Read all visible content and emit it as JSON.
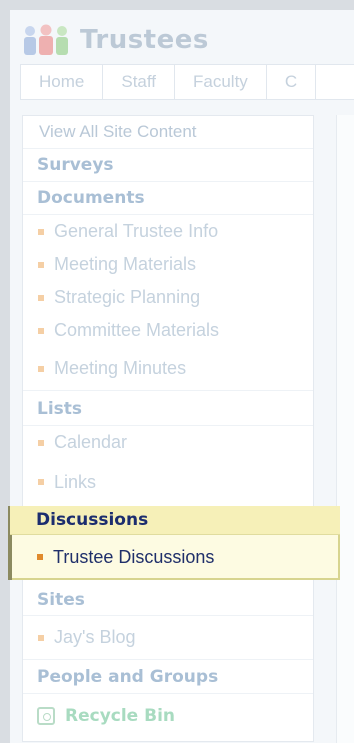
{
  "site": {
    "title": "Trustees"
  },
  "tabs": [
    {
      "label": "Home"
    },
    {
      "label": "Staff"
    },
    {
      "label": "Faculty"
    },
    {
      "label": "C"
    }
  ],
  "quicklaunch": {
    "view_all": "View All Site Content",
    "surveys": "Surveys",
    "documents": {
      "heading": "Documents",
      "items": [
        "General Trustee Info",
        "Meeting Materials",
        "Strategic Planning",
        "Committee Materials",
        "Meeting Minutes"
      ]
    },
    "lists": {
      "heading": "Lists",
      "items": [
        "Calendar",
        "Links"
      ]
    },
    "discussions": {
      "heading": "Discussions",
      "items": [
        "Trustee Discussions"
      ]
    },
    "sites": {
      "heading": "Sites",
      "items": [
        "Jay's Blog"
      ]
    },
    "people_and_groups": "People and Groups",
    "recycle_bin": "Recycle Bin"
  },
  "colors": {
    "highlight_bg": "#fdfbe2",
    "highlight_border": "#d7d48f",
    "selected_text": "#1f2f6a",
    "muted_link": "#c5d2de"
  }
}
